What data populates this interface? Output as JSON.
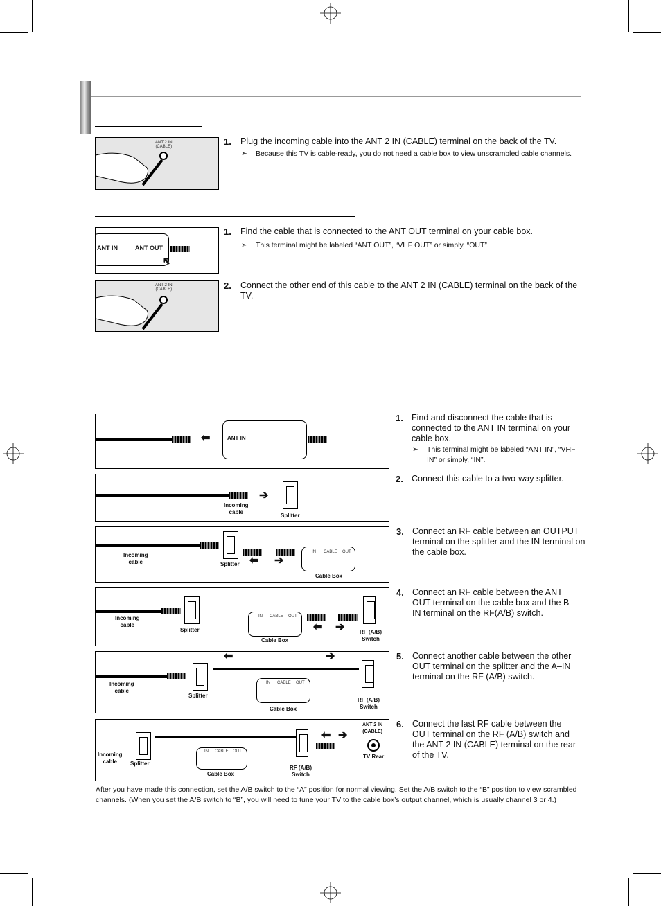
{
  "section1": {
    "figure": {
      "port_label": "ANT 2 IN\n(CABLE)"
    },
    "steps": [
      {
        "num": "1.",
        "text": "Plug the incoming cable into the ANT 2 IN (CABLE) terminal on the back of the TV.",
        "note": "Because this TV is cable-ready, you do not need a cable box to view unscrambled cable channels."
      }
    ]
  },
  "section2": {
    "figure1": {
      "ant_in": "ANT IN",
      "ant_out": "ANT OUT"
    },
    "figure2": {
      "port_label": "ANT 2 IN\n(CABLE)"
    },
    "steps": [
      {
        "num": "1.",
        "text": "Find the cable that is connected to the ANT OUT terminal on your cable box.",
        "note": "This terminal might be labeled “ANT OUT”, “VHF OUT” or simply, “OUT”."
      },
      {
        "num": "2.",
        "text": "Connect the other end of this cable to the ANT 2 IN (CABLE)  terminal on the back of the TV."
      }
    ]
  },
  "section3": {
    "labels": {
      "ant_in": "ANT IN",
      "incoming": "Incoming\ncable",
      "splitter": "Splitter",
      "cable_box": "Cable Box",
      "rf_switch": "RF (A/B)\nSwitch",
      "tv_rear": "TV Rear",
      "ant2": "ANT 2 IN\n(CABLE)",
      "box_in": "IN",
      "box_cable": "CABLE",
      "box_out": "OUT"
    },
    "steps": [
      {
        "num": "1.",
        "text": "Find and disconnect the cable that is connected to the ANT IN terminal on your cable box.",
        "note": "This terminal might be labeled “ANT IN”, “VHF IN” or simply, “IN”."
      },
      {
        "num": "2.",
        "text": "Connect this cable to a two-way splitter."
      },
      {
        "num": "3.",
        "text": "Connect an RF cable between an OUTPUT terminal on the splitter and the IN terminal on the cable box."
      },
      {
        "num": "4.",
        "text": "Connect an RF cable between the ANT OUT terminal on the cable box and the B–IN terminal on the RF(A/B) switch."
      },
      {
        "num": "5.",
        "text": "Connect another cable between the other OUT terminal on the splitter and the A–IN terminal on the RF (A/B) switch."
      },
      {
        "num": "6.",
        "text": "Connect the last RF cable between the OUT terminal on the RF (A/B) switch and the ANT 2 IN (CABLE) terminal on the rear of the TV."
      }
    ],
    "footer": "After you have made this connection, set the A/B switch to the “A” position for normal viewing. Set the A/B switch to the “B” position to view scrambled channels. (When you set the A/B switch to “B”, you will need to tune your TV to the cable box’s output channel, which is usually channel 3 or 4.)"
  },
  "icons": {
    "note": "arrowhead-note-icon",
    "registration": "crosshair-registration-mark"
  }
}
